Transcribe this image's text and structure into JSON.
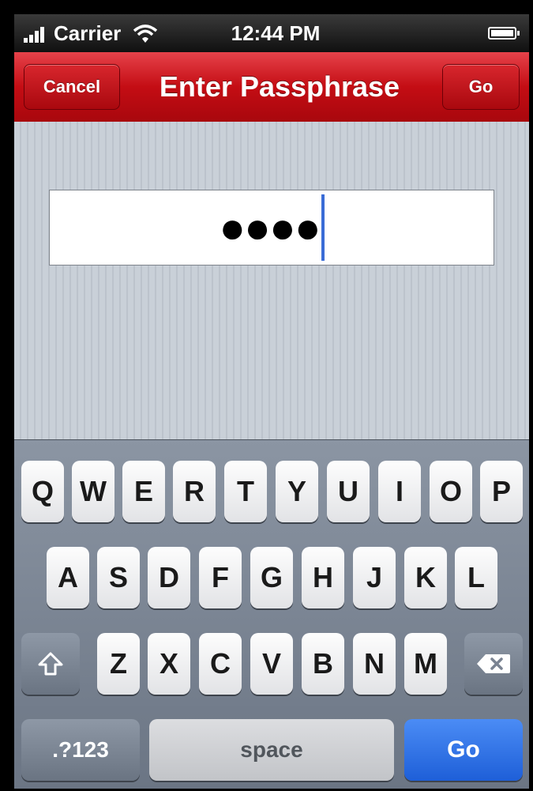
{
  "status_bar": {
    "carrier": "Carrier",
    "time": "12:44 PM"
  },
  "nav": {
    "title": "Enter Passphrase",
    "cancel_label": "Cancel",
    "go_label": "Go"
  },
  "passphrase": {
    "masked_value": "●●●●"
  },
  "keyboard": {
    "row1": [
      "Q",
      "W",
      "E",
      "R",
      "T",
      "Y",
      "U",
      "I",
      "O",
      "P"
    ],
    "row2": [
      "A",
      "S",
      "D",
      "F",
      "G",
      "H",
      "J",
      "K",
      "L"
    ],
    "row3": [
      "Z",
      "X",
      "C",
      "V",
      "B",
      "N",
      "M"
    ],
    "shift_icon": "shift-arrow-icon",
    "delete_icon": "backspace-icon",
    "numbers_label": ".?123",
    "space_label": "space",
    "go_label": "Go"
  },
  "colors": {
    "navbar_red": "#c40d14",
    "go_key_blue": "#2a6ee6",
    "caret_blue": "#3a6cd6"
  }
}
